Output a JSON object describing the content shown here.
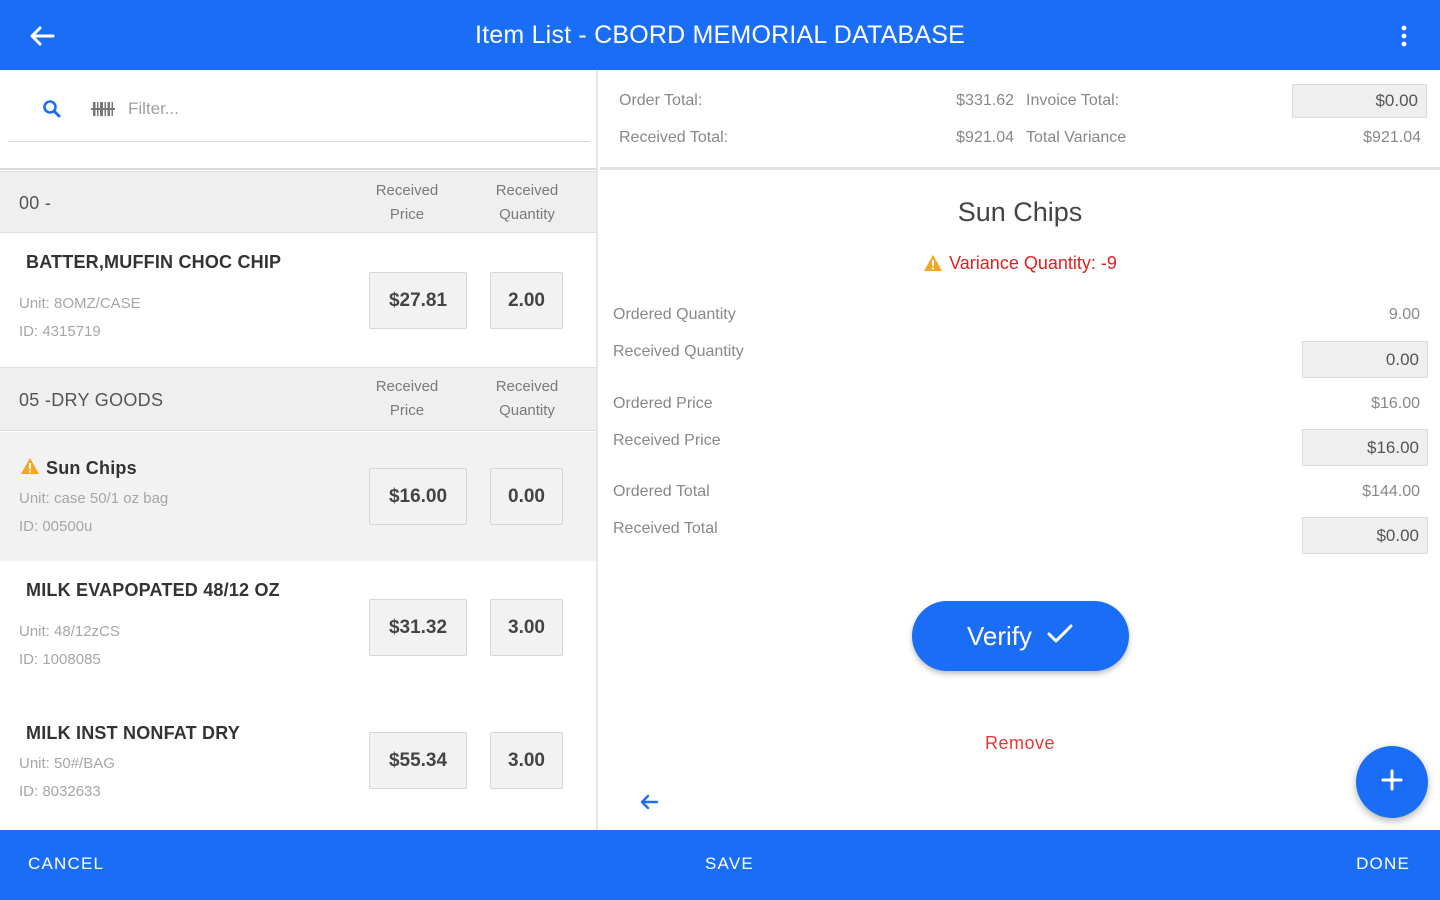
{
  "header": {
    "title": "Item List - CBORD MEMORIAL DATABASE"
  },
  "filter": {
    "placeholder": "Filter..."
  },
  "totals": {
    "order_total_label": "Order Total:",
    "order_total_value": "$331.62",
    "invoice_total_label": "Invoice Total:",
    "invoice_total_value": "$0.00",
    "received_total_label": "Received Total:",
    "received_total_value": "$921.04",
    "total_variance_label": "Total Variance",
    "total_variance_value": "$921.04"
  },
  "groups": [
    {
      "name": "00 -",
      "col_price": "Received Price",
      "col_qty": "Received Quantity",
      "items": [
        {
          "name": "BATTER,MUFFIN CHOC CHIP",
          "unit": "Unit: 8OMZ/CASE",
          "id": "ID: 4315719",
          "price": "$27.81",
          "qty": "2.00",
          "warning": false
        }
      ]
    },
    {
      "name": "05 -DRY GOODS",
      "col_price": "Received Price",
      "col_qty": "Received Quantity",
      "items": [
        {
          "name": "Sun Chips",
          "unit": "Unit: case 50/1 oz bag",
          "id": "ID: 00500u",
          "price": "$16.00",
          "qty": "0.00",
          "warning": true
        },
        {
          "name": "MILK EVAPOPATED 48/12 OZ",
          "unit": "Unit: 48/12zCS",
          "id": "ID: 1008085",
          "price": "$31.32",
          "qty": "3.00",
          "warning": false
        },
        {
          "name": "MILK INST NONFAT DRY",
          "unit": "Unit: 50#/BAG",
          "id": "ID: 8032633",
          "price": "$55.34",
          "qty": "3.00",
          "warning": false
        }
      ]
    }
  ],
  "detail": {
    "title": "Sun Chips",
    "variance": "Variance Quantity: -9",
    "ordered_quantity_label": "Ordered Quantity",
    "ordered_quantity_value": "9.00",
    "received_quantity_label": "Received Quantity",
    "received_quantity_value": "0.00",
    "ordered_price_label": "Ordered Price",
    "ordered_price_value": "$16.00",
    "received_price_label": "Received Price",
    "received_price_value": "$16.00",
    "ordered_total_label": "Ordered Total",
    "ordered_total_value": "$144.00",
    "received_total_label": "Received Total",
    "received_total_value": "$0.00",
    "verify_label": "Verify",
    "remove_label": "Remove"
  },
  "footer": {
    "cancel": "CANCEL",
    "save": "SAVE",
    "done": "DONE"
  },
  "colors": {
    "primary": "#1a6ef5",
    "danger": "#e02020",
    "warning": "#f5a623"
  },
  "icons": {
    "back": "back-arrow-icon",
    "more": "more-vert-icon",
    "search": "search-icon",
    "barcode": "barcode-icon",
    "warning": "warning-icon",
    "check": "check-icon",
    "add": "plus-icon"
  }
}
